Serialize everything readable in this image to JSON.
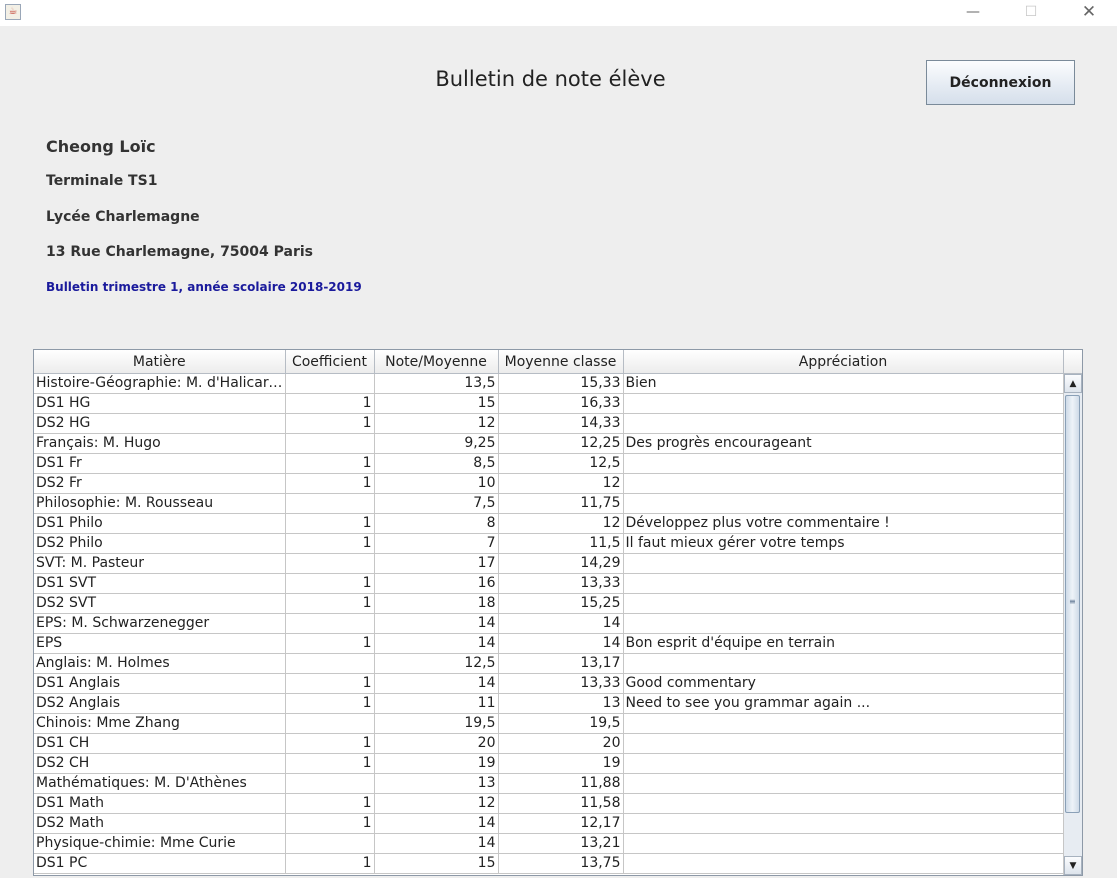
{
  "header": {
    "title": "Bulletin de note élève",
    "logout_label": "Déconnexion"
  },
  "student": {
    "name": "Cheong  Loïc",
    "class": "Terminale TS1",
    "school": "Lycée Charlemagne",
    "address": "13 Rue Charlemagne, 75004 Paris",
    "term": "Bulletin trimestre 1, année scolaire 2018-2019"
  },
  "table": {
    "headers": [
      "Matière",
      "Coefficient",
      "Note/Moyenne",
      "Moyenne classe",
      "Appréciation"
    ],
    "rows": [
      [
        "Histoire-Géographie: M. d'Halicarnas...",
        "",
        "13,5",
        "15,33",
        "Bien"
      ],
      [
        "DS1 HG",
        "1",
        "15",
        "16,33",
        ""
      ],
      [
        "DS2 HG",
        "1",
        "12",
        "14,33",
        ""
      ],
      [
        "Français: M. Hugo",
        "",
        "9,25",
        "12,25",
        "Des progrès encourageant"
      ],
      [
        "DS1 Fr",
        "1",
        "8,5",
        "12,5",
        ""
      ],
      [
        "DS2 Fr",
        "1",
        "10",
        "12",
        ""
      ],
      [
        "Philosophie: M. Rousseau",
        "",
        "7,5",
        "11,75",
        ""
      ],
      [
        "DS1 Philo",
        "1",
        "8",
        "12",
        "Développez plus votre commentaire !"
      ],
      [
        "DS2 Philo",
        "1",
        "7",
        "11,5",
        "Il faut mieux gérer votre temps"
      ],
      [
        "SVT: M. Pasteur",
        "",
        "17",
        "14,29",
        ""
      ],
      [
        "DS1 SVT",
        "1",
        "16",
        "13,33",
        ""
      ],
      [
        "DS2 SVT",
        "1",
        "18",
        "15,25",
        ""
      ],
      [
        "EPS: M. Schwarzenegger",
        "",
        "14",
        "14",
        ""
      ],
      [
        "EPS",
        "1",
        "14",
        "14",
        "Bon esprit d'équipe en terrain"
      ],
      [
        "Anglais: M. Holmes",
        "",
        "12,5",
        "13,17",
        ""
      ],
      [
        "DS1 Anglais",
        "1",
        "14",
        "13,33",
        "Good commentary"
      ],
      [
        "DS2 Anglais",
        "1",
        "11",
        "13",
        "Need to see you grammar again ..."
      ],
      [
        "Chinois: Mme Zhang",
        "",
        "19,5",
        "19,5",
        ""
      ],
      [
        "DS1 CH",
        "1",
        "20",
        "20",
        ""
      ],
      [
        "DS2 CH",
        "1",
        "19",
        "19",
        ""
      ],
      [
        "Mathématiques: M. D'Athènes",
        "",
        "13",
        "11,88",
        ""
      ],
      [
        "DS1 Math",
        "1",
        "12",
        "11,58",
        ""
      ],
      [
        "DS2 Math",
        "1",
        "14",
        "12,17",
        ""
      ],
      [
        "Physique-chimie: Mme Curie",
        "",
        "14",
        "13,21",
        ""
      ],
      [
        "DS1 PC",
        "1",
        "15",
        "13,75",
        ""
      ]
    ]
  },
  "icons": {
    "app": "java-icon",
    "minimize": "minimize-icon",
    "maximize": "maximize-icon",
    "close": "close-icon",
    "scroll_up": "arrow-up-icon",
    "scroll_down": "arrow-down-icon"
  }
}
